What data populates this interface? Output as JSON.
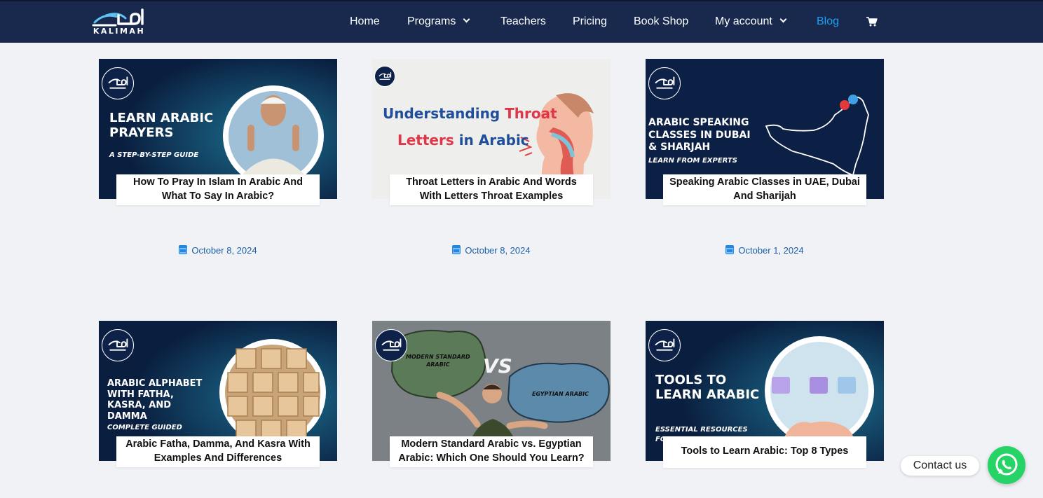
{
  "header": {
    "logo_text": "KALIMAH",
    "menu": [
      {
        "label": "Home"
      },
      {
        "label": "Programs"
      },
      {
        "label": "Teachers"
      },
      {
        "label": "Pricing"
      },
      {
        "label": "Book Shop"
      },
      {
        "label": "My account"
      },
      {
        "label": "Blog"
      }
    ],
    "cart_icon": "cart-icon",
    "colors": {
      "bar": "#18294d",
      "active": "#1ea1f2"
    }
  },
  "posts": [
    {
      "image_text": [
        "LEARN ARABIC",
        "PRAYERS",
        "A STEP-BY-STEP GUIDE"
      ],
      "title": "How To Pray In Islam In Arabic And What To Say In Arabic?",
      "date": "October 8, 2024"
    },
    {
      "image_text": [
        "Understanding",
        "Throat",
        "Letters",
        "in Arabic"
      ],
      "title": "Throat Letters in Arabic And Words With Letters Throat Examples",
      "date": "October 8, 2024"
    },
    {
      "image_text": [
        "ARABIC SPEAKING",
        "CLASSES IN DUBAI",
        "& SHARJAH",
        "LEARN FROM EXPERTS"
      ],
      "title": "Speaking Arabic Classes in UAE, Dubai And Sharijah",
      "date": "October 1, 2024"
    },
    {
      "image_text": [
        "ARABIC ALPHABET",
        "WITH FATHA,",
        "KASRA, AND",
        "DAMMA",
        "COMPLETE GUIDED"
      ],
      "title": "Arabic Fatha, Damma, And Kasra With Examples And Differences",
      "date": ""
    },
    {
      "image_text": [
        "MODERN STANDARD",
        "ARABIC",
        "VS",
        "EGYPTIAN ARABIC"
      ],
      "title": "Modern Standard Arabic vs. Egyptian Arabic: Which One Should You Learn?",
      "date": ""
    },
    {
      "image_text": [
        "TOOLS TO",
        "LEARN ARABIC",
        "ESSENTIAL RESOURCES",
        "FO"
      ],
      "title": "Tools to Learn Arabic: Top 8 Types",
      "date": ""
    }
  ],
  "badge_text": "KALIMAH",
  "contact": {
    "label": "Contact us",
    "icon": "whatsapp-icon",
    "color": "#25d366"
  }
}
